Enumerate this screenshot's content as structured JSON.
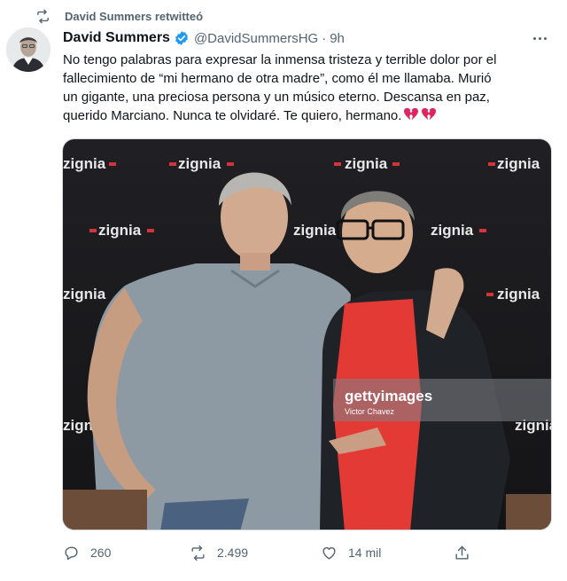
{
  "retweet_banner": {
    "text": "David Summers retwitteó"
  },
  "tweet": {
    "display_name": "David Summers",
    "handle": "@DavidSummersHG",
    "separator": "·",
    "time": "9h",
    "text": "No tengo palabras para expresar la inmensa tristeza y terrible dolor por el\nfallecimiento de “mi hermano de otra madre”, como él me llamaba. Murió\nun gigante, una preciosa persona y un músico eterno. Descansa en paz,\nquerido Marciano. Nunca te olvidaré. Te quiero, hermano.",
    "emoji": [
      "broken-heart",
      "broken-heart"
    ]
  },
  "media": {
    "backdrop_logo": "zignia",
    "watermark_brand": "gettyimages",
    "watermark_credit": "Victor Chavez"
  },
  "actions": {
    "replies": "260",
    "retweets": "2.499",
    "likes": "14 mil"
  },
  "colors": {
    "secondary_text": "#536471",
    "verified": "#1d9bf0",
    "heart": "#e0245e",
    "backdrop": "#1b1b1f",
    "logo_red": "#d4333a"
  }
}
